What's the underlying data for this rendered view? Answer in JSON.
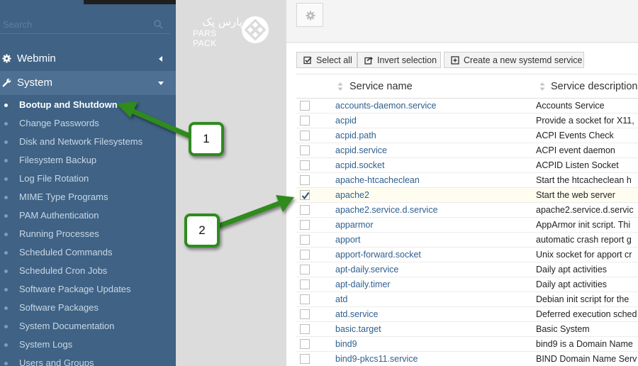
{
  "search": {
    "placeholder": "Search",
    "icon": "search-icon"
  },
  "sidebar": {
    "sections": [
      {
        "label": "Webmin",
        "icon": "gear-icon",
        "expanded": false
      },
      {
        "label": "System",
        "icon": "wrench-icon",
        "expanded": true
      }
    ],
    "items": [
      "Bootup and Shutdown",
      "Change Passwords",
      "Disk and Network Filesystems",
      "Filesystem Backup",
      "Log File Rotation",
      "MIME Type Programs",
      "PAM Authentication",
      "Running Processes",
      "Scheduled Commands",
      "Scheduled Cron Jobs",
      "Software Package Updates",
      "Software Packages",
      "System Documentation",
      "System Logs",
      "Users and Groups"
    ],
    "active_item": "Bootup and Shutdown"
  },
  "logo": {
    "text_fa": "پارس پک",
    "text_en": "PARS PACK"
  },
  "toolbar": {
    "select_all": "Select all",
    "invert_selection": "Invert selection",
    "create_service": "Create a new systemd service"
  },
  "table": {
    "headers": {
      "name": "Service name",
      "description": "Service description"
    },
    "rows": [
      {
        "name": "accounts-daemon.service",
        "description": "Accounts Service",
        "checked": false
      },
      {
        "name": "acpid",
        "description": "Provide a socket for X11,",
        "checked": false
      },
      {
        "name": "acpid.path",
        "description": "ACPI Events Check",
        "checked": false
      },
      {
        "name": "acpid.service",
        "description": "ACPI event daemon",
        "checked": false
      },
      {
        "name": "acpid.socket",
        "description": "ACPID Listen Socket",
        "checked": false
      },
      {
        "name": "apache-htcacheclean",
        "description": "Start the htcacheclean h",
        "checked": false
      },
      {
        "name": "apache2",
        "description": "Start the web server",
        "checked": true
      },
      {
        "name": "apache2.service.d.service",
        "description": "apache2.service.d.servic",
        "checked": false
      },
      {
        "name": "apparmor",
        "description": "AppArmor init script. Thi",
        "checked": false
      },
      {
        "name": "apport",
        "description": "automatic crash report g",
        "checked": false
      },
      {
        "name": "apport-forward.socket",
        "description": "Unix socket for apport cr",
        "checked": false
      },
      {
        "name": "apt-daily.service",
        "description": "Daily apt activities",
        "checked": false
      },
      {
        "name": "apt-daily.timer",
        "description": "Daily apt activities",
        "checked": false
      },
      {
        "name": "atd",
        "description": "Debian init script for the",
        "checked": false
      },
      {
        "name": "atd.service",
        "description": "Deferred execution sched",
        "checked": false
      },
      {
        "name": "basic.target",
        "description": "Basic System",
        "checked": false
      },
      {
        "name": "bind9",
        "description": "bind9 is a Domain Name",
        "checked": false
      },
      {
        "name": "bind9-pkcs11.service",
        "description": "BIND Domain Name Serv",
        "checked": false
      }
    ]
  },
  "annotations": [
    {
      "label": "1",
      "target": "Bootup and Shutdown"
    },
    {
      "label": "2",
      "target": "apache2"
    }
  ],
  "colors": {
    "sidebar_bg": "#3f6285",
    "sidebar_active_bg": "#4d7093",
    "link": "#2f5f8f",
    "annotation_green": "#2e8b1e"
  }
}
